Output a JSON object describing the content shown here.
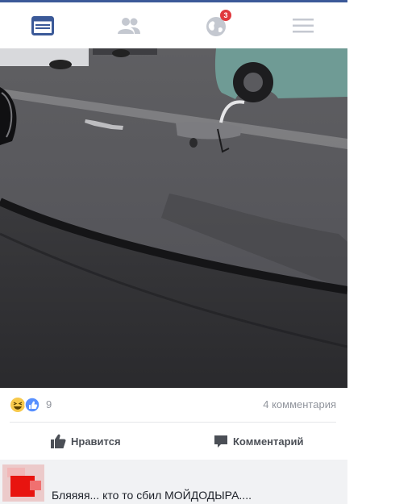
{
  "app": {
    "accent_color": "#3b5998"
  },
  "navbar": {
    "items": [
      {
        "icon": "news-feed-icon",
        "active": true
      },
      {
        "icon": "friends-icon",
        "active": false
      },
      {
        "icon": "notifications-globe-icon",
        "active": false,
        "badge": "3"
      },
      {
        "icon": "menu-icon",
        "active": false
      }
    ]
  },
  "post": {
    "photo": {
      "description_icon": "post-photo"
    },
    "reactions": {
      "icons": [
        "haha-reaction-icon",
        "like-reaction-icon"
      ],
      "count": "9"
    },
    "comment_count": "4 комментария",
    "actions": {
      "like_label": "Нравится",
      "comment_label": "Комментарий"
    }
  },
  "comment": {
    "text": "Бляяяя... кто то сбил МОЙДОДЫРА...."
  }
}
